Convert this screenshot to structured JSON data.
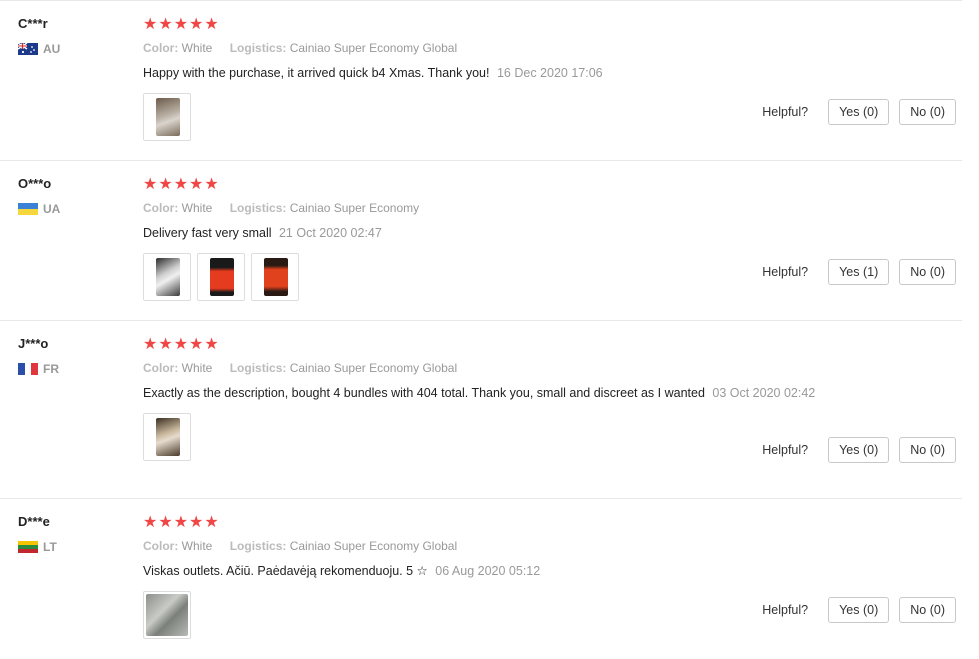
{
  "reviews": [
    {
      "user": "C***r",
      "country": "AU",
      "stars": "★★★★★",
      "color_key": "Color:",
      "color_val": "White",
      "logistics_key": "Logistics:",
      "logistics_val": "Cainiao Super Economy Global",
      "text": "Happy with the purchase, it arrived quick b4 Xmas. Thank you!",
      "date": "16 Dec 2020 17:06",
      "helpful_label": "Helpful?",
      "yes_label": "Yes (0)",
      "no_label": "No (0)"
    },
    {
      "user": "O***o",
      "country": "UA",
      "stars": "★★★★★",
      "color_key": "Color:",
      "color_val": "White",
      "logistics_key": "Logistics:",
      "logistics_val": "Cainiao Super Economy",
      "text": "Delivery fast very small",
      "date": "21 Oct 2020 02:47",
      "helpful_label": "Helpful?",
      "yes_label": "Yes (1)",
      "no_label": "No (0)"
    },
    {
      "user": "J***o",
      "country": "FR",
      "stars": "★★★★★",
      "color_key": "Color:",
      "color_val": "White",
      "logistics_key": "Logistics:",
      "logistics_val": "Cainiao Super Economy Global",
      "text": "Exactly as the description, bought 4 bundles with 404 total. Thank you, small and discreet as I wanted",
      "date": "03 Oct 2020 02:42",
      "helpful_label": "Helpful?",
      "yes_label": "Yes (0)",
      "no_label": "No (0)"
    },
    {
      "user": "D***e",
      "country": "LT",
      "stars": "★★★★★",
      "color_key": "Color:",
      "color_val": "White",
      "logistics_key": "Logistics:",
      "logistics_val": "Cainiao Super Economy Global",
      "text": "Viskas outlets. Ačiū. Paėdavėją rekomenduoju. 5 ☆",
      "date": "06 Aug 2020 05:12",
      "helpful_label": "Helpful?",
      "yes_label": "Yes (0)",
      "no_label": "No (0)"
    }
  ],
  "colors": {
    "star": "#f04646",
    "muted": "#999999",
    "border": "#c8c8c8"
  }
}
